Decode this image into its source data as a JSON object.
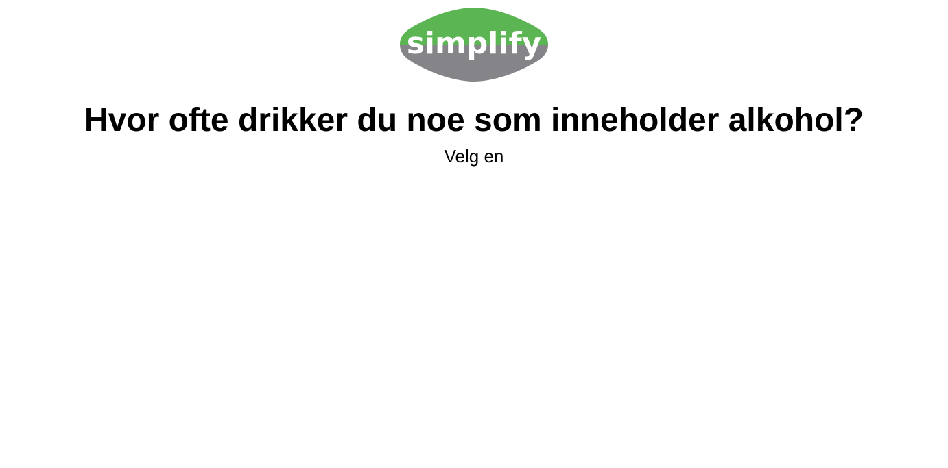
{
  "brand": {
    "logo_text": "simplify",
    "logo_icon": "simplify-logo",
    "top_color": "#5ab552",
    "bottom_color": "#858589",
    "text_color": "#ffffff"
  },
  "question": {
    "title": "Hvor ofte drikker du noe som inneholder alkohol?",
    "instruction": "Velg en"
  }
}
